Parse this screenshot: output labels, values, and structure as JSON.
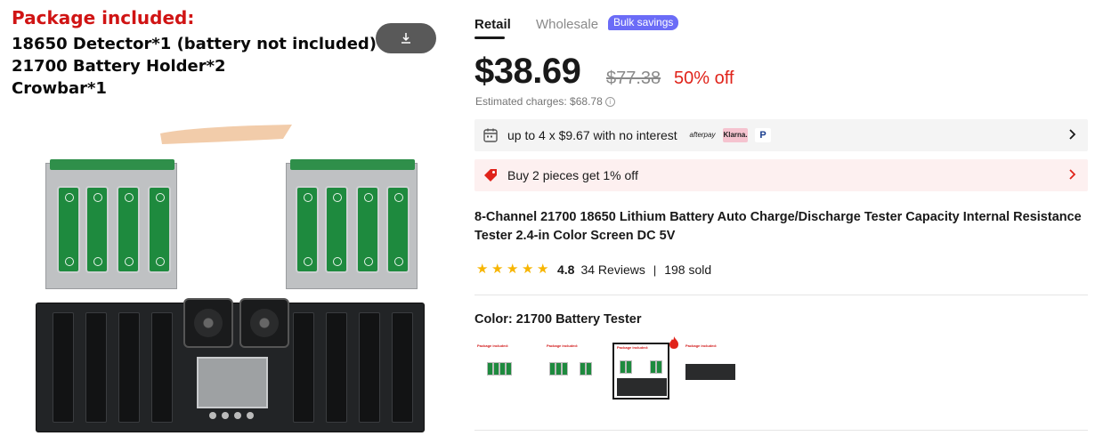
{
  "image_panel": {
    "package_title": "Package included:",
    "lines": [
      "18650 Detector*1 (battery not included)",
      "21700 Battery Holder*2",
      "Crowbar*1"
    ],
    "download_icon": "download-icon"
  },
  "tabs": {
    "retail": "Retail",
    "wholesale": "Wholesale",
    "bulk_badge": "Bulk savings"
  },
  "pricing": {
    "price": "$38.69",
    "original_price": "$77.38",
    "discount": "50% off",
    "estimated_charges": "Estimated charges: $68.78"
  },
  "installment": {
    "text": "up to 4 x $9.67 with no interest",
    "afterpay": "afterpay",
    "klarna": "Klarna.",
    "paypal": "P"
  },
  "promo": {
    "text": "Buy 2 pieces get 1% off"
  },
  "product": {
    "title": "8-Channel 21700 18650 Lithium Battery Auto Charge/Discharge Tester Capacity Internal Resistance Tester 2.4-in Color Screen DC 5V",
    "rating": "4.8",
    "reviews": "34 Reviews",
    "separator": "|",
    "sold": "198 sold",
    "stars": 5
  },
  "color": {
    "label": "Color: 21700 Battery Tester",
    "thumb_caption": "Package included:"
  },
  "colors": {
    "accent_price": "#191919",
    "discount_red": "#e0231a",
    "bulk_badge": "#6b6cf7",
    "star": "#f7b500"
  }
}
